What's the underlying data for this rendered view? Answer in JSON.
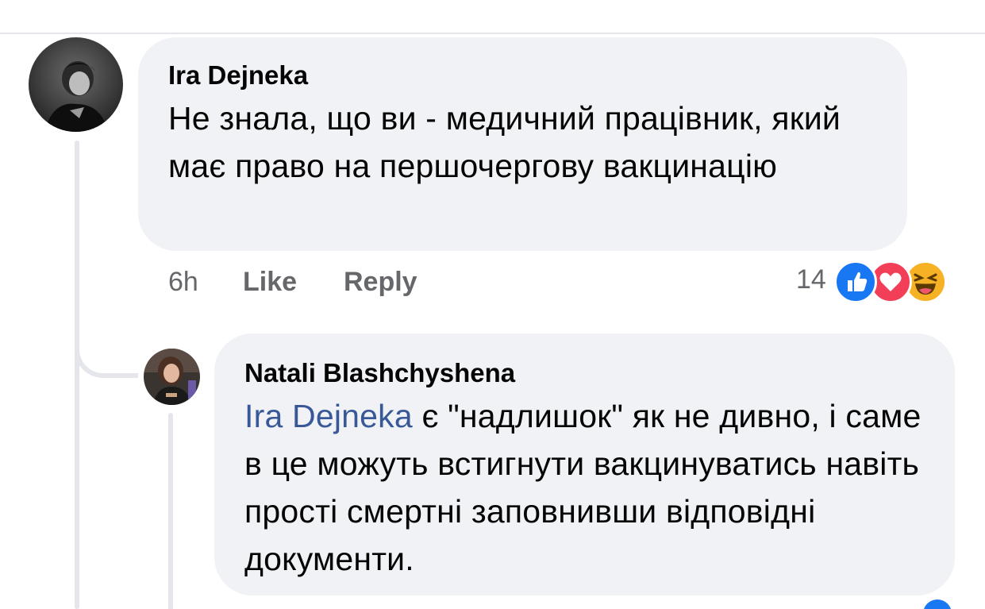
{
  "comment": {
    "author": "Ira Dejneka",
    "text": "Не знала, що ви - медичний працівник, який має право на першочергову вакцинацію",
    "time": "6h",
    "like_label": "Like",
    "reply_label": "Reply",
    "reaction_count": "14",
    "reactions": [
      "like-icon",
      "love-icon",
      "haha-icon"
    ]
  },
  "reply": {
    "author": "Natali Blashchyshena",
    "mention": "Ira Dejneka",
    "text": " є \"надлишок\" як не дивно, і саме в це можуть встигнути вакцинуватись навіть прості смертні заповнивши відповідні документи."
  },
  "colors": {
    "bubble": "#f0f2f5",
    "mention": "#385898",
    "meta": "#65676b",
    "like": "#1877f2",
    "love": "#f33e58",
    "haha": "#f7b125"
  }
}
